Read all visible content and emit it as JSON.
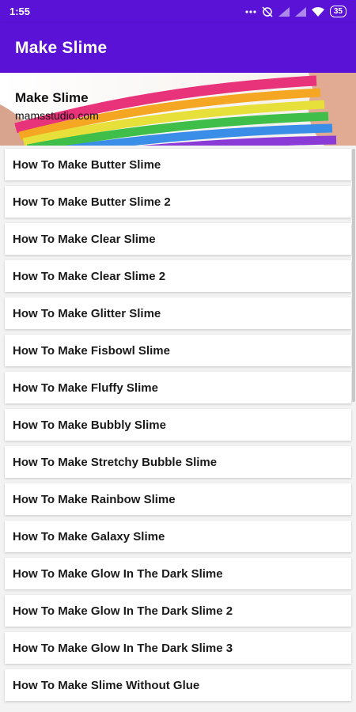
{
  "status_bar": {
    "time": "1:55",
    "battery": "35",
    "icons": [
      "more-dots-icon",
      "alarm-icon",
      "signal-icon",
      "signal-icon",
      "wifi-icon",
      "battery-icon"
    ]
  },
  "app_bar": {
    "title": "Make Slime"
  },
  "banner": {
    "title": "Make Slime",
    "subtitle": "mamsstudio.com"
  },
  "list": {
    "items": [
      "How To Make Butter Slime",
      "How To Make Butter Slime 2",
      "How To Make Clear Slime",
      "How To Make Clear Slime 2",
      "How To Make Glitter Slime",
      "How To Make Fisbowl Slime",
      "How To Make Fluffy Slime",
      "How To Make Bubbly Slime",
      "How To Make Stretchy Bubble Slime",
      "How To Make Rainbow Slime",
      "How To Make Galaxy Slime",
      "How To Make Glow In The Dark Slime",
      "How To Make Glow In The Dark Slime 2",
      "How To Make Glow In The Dark Slime 3",
      "How To Make Slime Without Glue"
    ]
  },
  "colors": {
    "primary": "#5a12d6"
  }
}
